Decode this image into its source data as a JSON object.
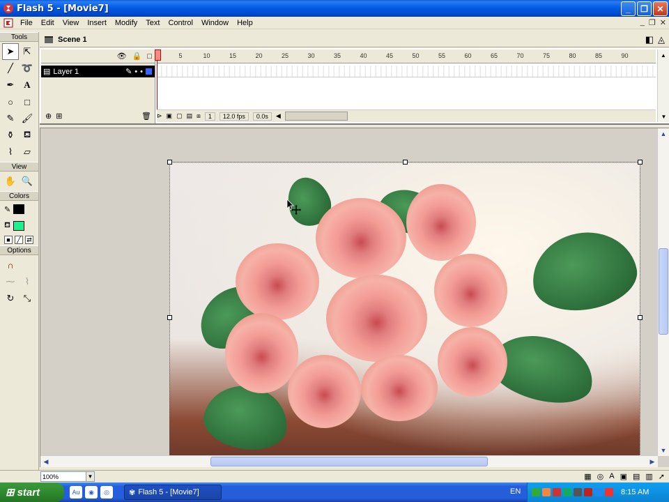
{
  "window": {
    "title": "Flash 5 - [Movie7]"
  },
  "menubar": {
    "items": [
      "File",
      "Edit",
      "View",
      "Insert",
      "Modify",
      "Text",
      "Control",
      "Window",
      "Help"
    ]
  },
  "tools": {
    "sections": {
      "tools": "Tools",
      "view": "View",
      "colors": "Colors",
      "options": "Options"
    },
    "stroke_color": "#000000",
    "fill_color": "#1ef08a"
  },
  "scene": {
    "label": "Scene 1"
  },
  "timeline": {
    "layer_name": "Layer 1",
    "frame_labels": [
      "1",
      "5",
      "10",
      "15",
      "20",
      "25",
      "30",
      "35",
      "40",
      "45",
      "50",
      "55",
      "60",
      "65",
      "70",
      "75",
      "80",
      "85",
      "90"
    ],
    "current_frame": "1",
    "frame_rate": "12.0 fps",
    "elapsed": "0.0s"
  },
  "statusbar": {
    "zoom": "100%"
  },
  "taskbar": {
    "start_label": "start",
    "task_label": "Flash 5 - [Movie7]",
    "quicklaunch": [
      "Au"
    ],
    "language": "EN",
    "clock": "8:15 AM"
  }
}
